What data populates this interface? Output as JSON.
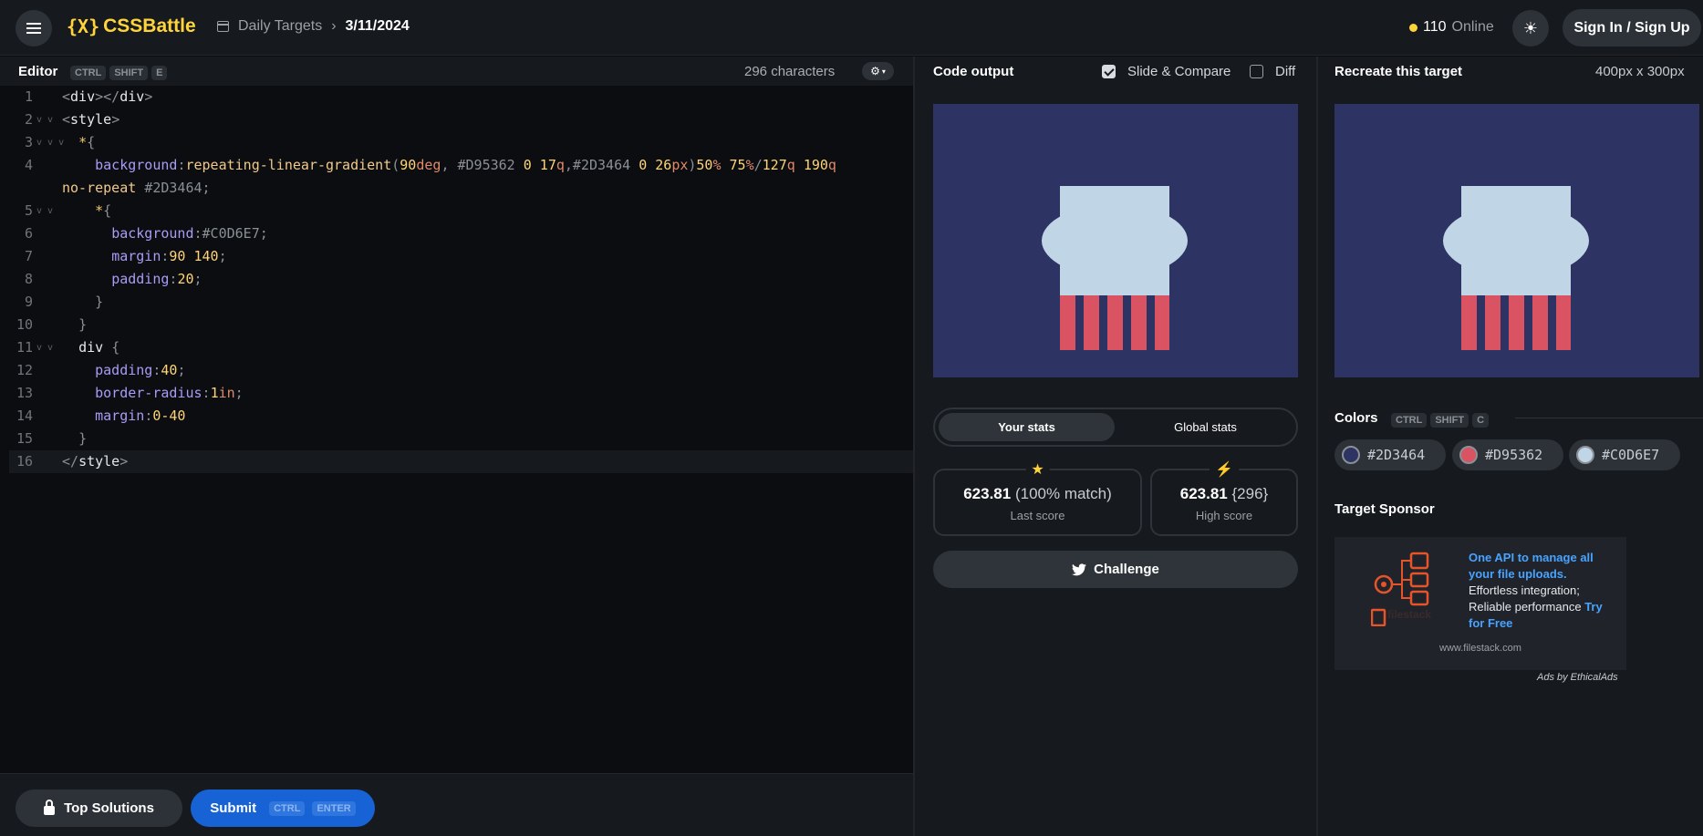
{
  "header": {
    "logo_text": "CSSBattle",
    "logo_mark": "{X}",
    "breadcrumb_section": "Daily Targets",
    "breadcrumb_date": "3/11/2024",
    "online_count": "110",
    "online_label": "Online",
    "signin_label": "Sign In / Sign Up"
  },
  "editor": {
    "title": "Editor",
    "shortcut": [
      "CTRL",
      "SHIFT",
      "E"
    ],
    "char_count": "296 characters",
    "code_lines": [
      "<div></div>",
      "<style>",
      "  *{",
      "    background:repeating-linear-gradient(90deg, #D95362 0 17q,#2D3464 0 26px)50% 75%/127q 190q",
      "no-repeat #2D3464;",
      "    *{",
      "      background:#C0D6E7;",
      "      margin:90 140;",
      "      padding:20;",
      "    }",
      "  }",
      "  div {",
      "    padding:40;",
      "    border-radius:1in;",
      "    margin:0-40",
      "  }",
      "</style>"
    ],
    "line_numbers": [
      "1",
      "2",
      "3",
      "4",
      "",
      "5",
      "6",
      "7",
      "8",
      "9",
      "10",
      "11",
      "12",
      "13",
      "14",
      "15",
      "16"
    ],
    "top_solutions_label": "Top Solutions",
    "submit_label": "Submit",
    "submit_shortcut": [
      "CTRL",
      "ENTER"
    ]
  },
  "output": {
    "title": "Code output",
    "slide_compare_label": "Slide & Compare",
    "slide_compare_checked": true,
    "diff_label": "Diff",
    "diff_checked": false,
    "tab_your_stats": "Your stats",
    "tab_global_stats": "Global stats",
    "last_score_value": "623.81",
    "last_score_match": "(100% match)",
    "last_score_label": "Last score",
    "high_score_value": "623.81",
    "high_score_chars": "{296}",
    "high_score_label": "High score",
    "challenge_label": "Challenge"
  },
  "target": {
    "title": "Recreate this target",
    "size": "400px x 300px",
    "colors_title": "Colors",
    "colors_shortcut": [
      "CTRL",
      "SHIFT",
      "C"
    ],
    "colors": [
      {
        "hex": "#2D3464",
        "label": "#2D3464"
      },
      {
        "hex": "#D95362",
        "label": "#D95362"
      },
      {
        "hex": "#C0D6E7",
        "label": "#C0D6E7"
      }
    ],
    "sponsor_title": "Target Sponsor",
    "ad_headline": "One API to manage all your file uploads.",
    "ad_body": "Effortless integration; Reliable performance",
    "ad_cta": "Try for Free",
    "ad_brand": "filestack",
    "ad_site": "www.filestack.com",
    "ethical_ads": "Ads by EthicalAds"
  }
}
